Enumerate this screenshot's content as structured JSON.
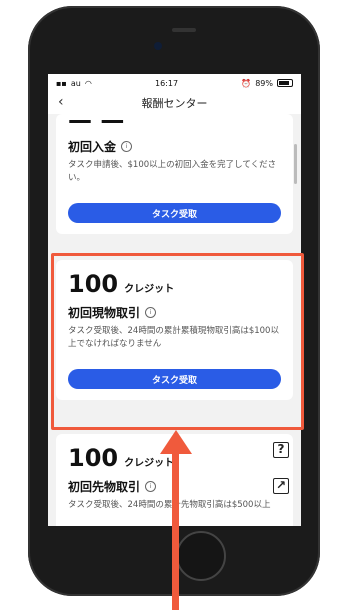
{
  "status_bar": {
    "carrier": "au",
    "time": "16:17",
    "battery": "89%"
  },
  "header": {
    "back": "‹",
    "title": "報酬センター"
  },
  "cards": [
    {
      "credits": "",
      "unit": "",
      "title": "初回入金",
      "desc": "タスク申請後、$100以上の初回入金を完了してください。",
      "button": "タスク受取"
    },
    {
      "credits": "100",
      "unit": "クレジット",
      "title": "初回現物取引",
      "desc": "タスク受取後、24時間の累計累積現物取引高は$100以上でなければなりません",
      "button": "タスク受取"
    },
    {
      "credits": "100",
      "unit": "クレジット",
      "title": "初回先物取引",
      "desc": "タスク受取後、24時間の累計先物取引高は$500以上"
    }
  ],
  "colors": {
    "accent": "#2a5ce6",
    "highlight": "#f05a3c"
  },
  "icons": {
    "help": "question-box-icon",
    "share": "external-link-icon"
  }
}
